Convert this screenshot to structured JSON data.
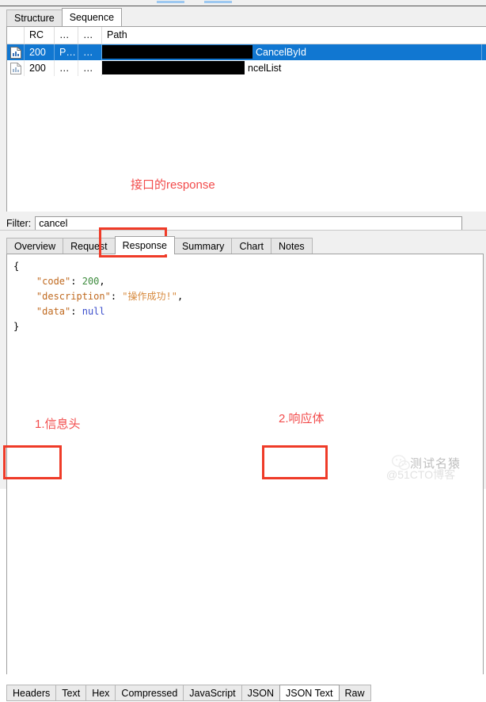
{
  "window": {
    "top_marks": [
      "highlight-bar-1",
      "highlight-bar-2"
    ]
  },
  "session_panel": {
    "tabs": [
      {
        "label": "Structure",
        "active": false
      },
      {
        "label": "Sequence",
        "active": true
      }
    ],
    "columns": [
      "",
      "RC",
      "…",
      "…",
      "Path"
    ],
    "rows": [
      {
        "icon": "document-chart-icon",
        "rc": "200",
        "col_d1": "P…",
        "col_d2": "…",
        "path_redacted": true,
        "path_visible_suffix": "CancelById",
        "selected": true
      },
      {
        "icon": "document-chart-icon",
        "rc": "200",
        "col_d1": "…",
        "col_d2": "…",
        "path_redacted": true,
        "path_visible_suffix": "ncelList",
        "selected": false
      }
    ],
    "filter": {
      "label": "Filter:",
      "value": "cancel",
      "placeholder": ""
    }
  },
  "inspector": {
    "tabs": [
      {
        "label": "Overview",
        "active": false
      },
      {
        "label": "Request",
        "active": false
      },
      {
        "label": "Response",
        "active": true
      },
      {
        "label": "Summary",
        "active": false
      },
      {
        "label": "Chart",
        "active": false
      },
      {
        "label": "Notes",
        "active": false
      }
    ],
    "response_body": {
      "open_brace": "{",
      "lines": [
        {
          "key": "\"code\"",
          "sep": ": ",
          "value": "200",
          "value_type": "number",
          "trail": ","
        },
        {
          "key": "\"description\"",
          "sep": ": ",
          "value": "\"操作成功!\"",
          "value_type": "string",
          "trail": ","
        },
        {
          "key": "\"data\"",
          "sep": ": ",
          "value": "null",
          "value_type": "null",
          "trail": ""
        }
      ],
      "close_brace": "}"
    },
    "bottom_tabs": [
      {
        "label": "Headers",
        "active": false
      },
      {
        "label": "Text",
        "active": false
      },
      {
        "label": "Hex",
        "active": false
      },
      {
        "label": "Compressed",
        "active": false
      },
      {
        "label": "JavaScript",
        "active": false
      },
      {
        "label": "JSON",
        "active": false
      },
      {
        "label": "JSON Text",
        "active": true
      },
      {
        "label": "Raw",
        "active": false
      }
    ]
  },
  "annotations": {
    "color": "#f24b4b",
    "box_color": "#ef3b28",
    "response_note": "接口的response",
    "note_one": "1.信息头",
    "note_two": "2.响应体"
  },
  "watermark": {
    "title": "测试名猿",
    "subtitle": "@51CTO博客",
    "icon": "wechat-icon"
  }
}
